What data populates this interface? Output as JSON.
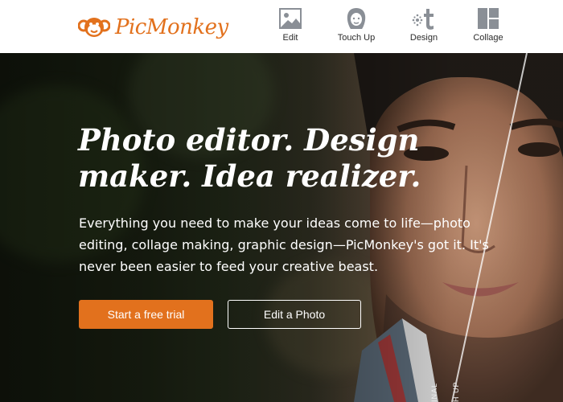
{
  "brand": {
    "name": "PicMonkey",
    "accent_color": "#e2711d"
  },
  "nav": {
    "items": [
      {
        "label": "Edit",
        "icon": "edit-photo-icon"
      },
      {
        "label": "Touch Up",
        "icon": "touch-up-face-icon"
      },
      {
        "label": "Design",
        "icon": "design-icon"
      },
      {
        "label": "Collage",
        "icon": "collage-grid-icon"
      }
    ]
  },
  "hero": {
    "headline_line1": "Photo editor. Design",
    "headline_line2": "maker. Idea realizer.",
    "subtext": "Everything you need to make your ideas come to life—photo editing, collage making, graphic design—PicMonkey's got it. It's never been easier to feed your creative beast.",
    "primary_button": "Start a free trial",
    "secondary_button": "Edit a Photo",
    "left_tag": "INAL",
    "right_tag": "H UP"
  }
}
